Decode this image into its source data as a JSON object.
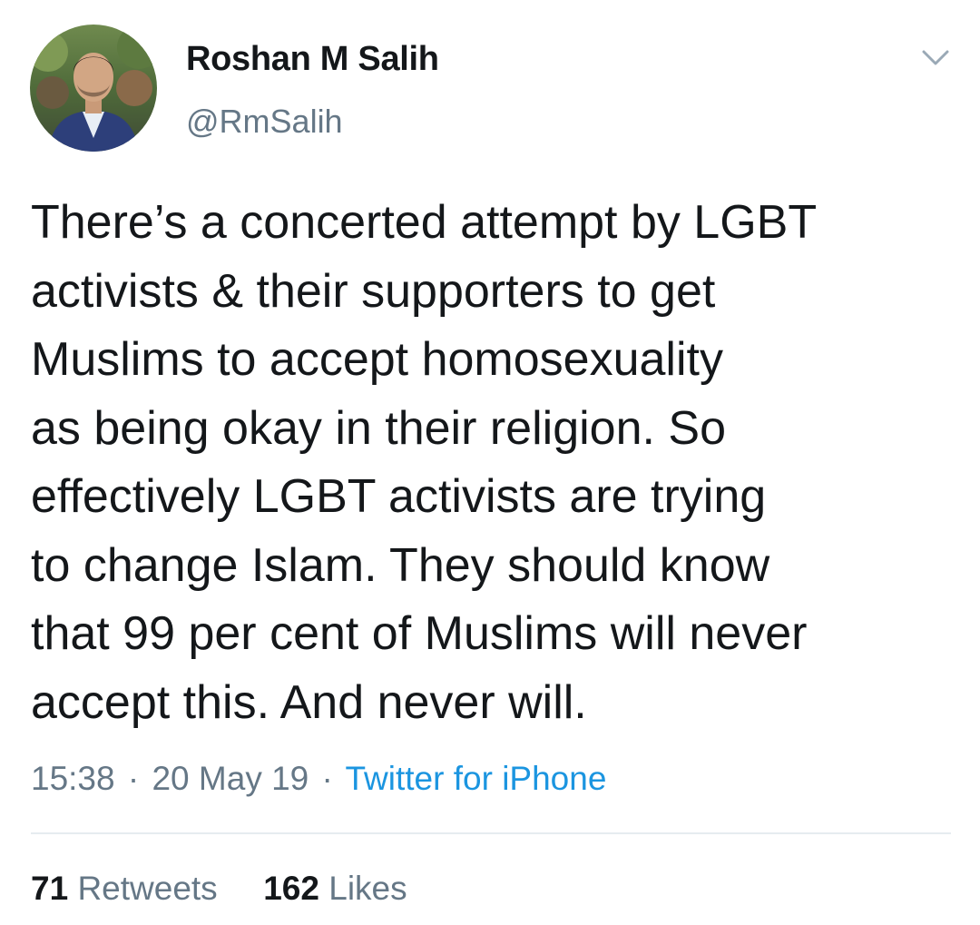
{
  "author": {
    "display_name": "Roshan M Salih",
    "handle": "@RmSalih",
    "avatar_icon": "profile-photo"
  },
  "menu": {
    "icon": "chevron-down-icon"
  },
  "tweet": {
    "lines": [
      "There’s a concerted attempt by LGBT",
      "activists & their supporters to get",
      "Muslims to accept homosexuality",
      "as being okay in their religion. So",
      "effectively LGBT activists are trying",
      "to change Islam. They should know",
      "that 99 per cent of Muslims will never",
      "accept this. And never will."
    ]
  },
  "meta": {
    "time": "15:38",
    "separator": "·",
    "date": "20 May 19",
    "source": "Twitter for iPhone"
  },
  "stats": {
    "retweets_count": "71",
    "retweets_label": "Retweets",
    "likes_count": "162",
    "likes_label": "Likes"
  },
  "colors": {
    "text": "#14171a",
    "secondary": "#657786",
    "link": "#1b95e0",
    "divider": "#e6ecf0"
  }
}
